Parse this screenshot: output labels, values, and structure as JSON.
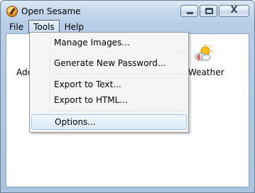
{
  "window": {
    "title": "Open Sesame",
    "icon": "key-icon"
  },
  "menubar": {
    "items": [
      "File",
      "Tools",
      "Help"
    ],
    "active": "Tools"
  },
  "client": {
    "left_label": "Add",
    "right_label": "Weather",
    "right_icon": "weather-icon"
  },
  "tools_menu": {
    "items": [
      "Manage Images...",
      "Generate New Password...",
      "Export to Text...",
      "Export to HTML...",
      "Options..."
    ],
    "highlighted": "Options..."
  },
  "caption": {
    "close_glyph": "X"
  }
}
